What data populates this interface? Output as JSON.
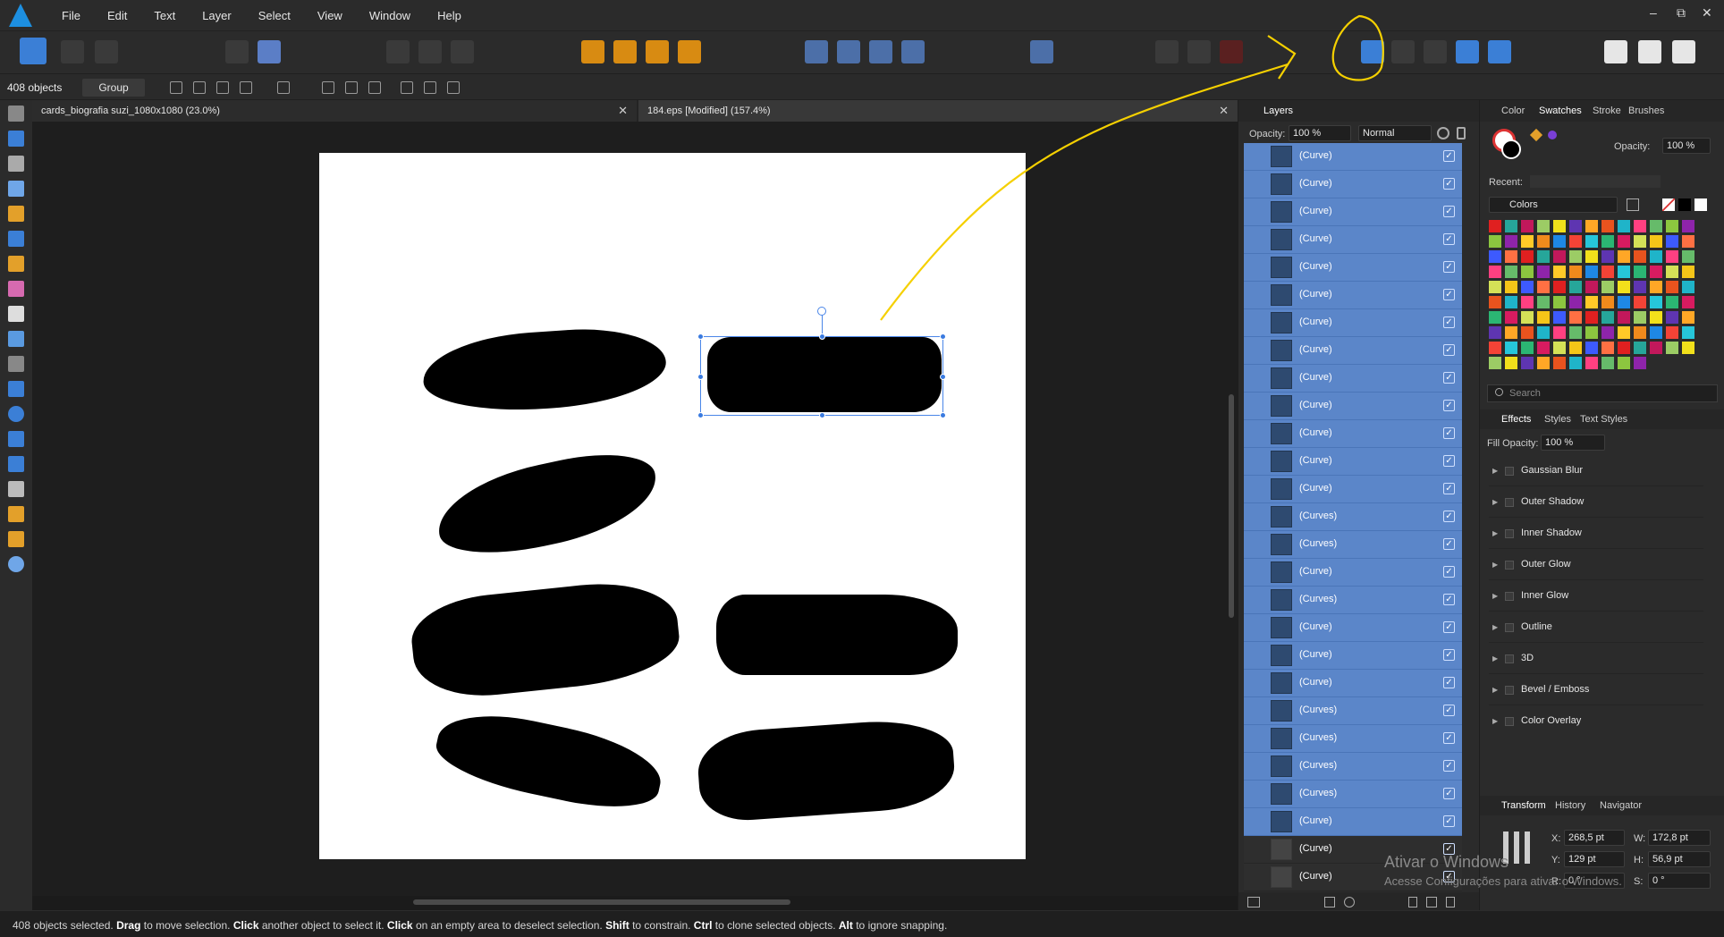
{
  "menu": {
    "items": [
      "File",
      "Edit",
      "Text",
      "Layer",
      "Select",
      "View",
      "Window",
      "Help"
    ]
  },
  "window_controls": {
    "minimize": "–",
    "restore": "⧉",
    "close": "✕"
  },
  "context": {
    "object_count": "408 objects",
    "group_label": "Group"
  },
  "tabs": [
    {
      "label": "cards_biografia suzi_1080x1080 (23.0%)",
      "close": "✕"
    },
    {
      "label": "184.eps [Modified] (157.4%)",
      "close": "✕"
    }
  ],
  "layers_panel": {
    "tab": "Layers",
    "opacity_label": "Opacity:",
    "opacity_value": "100 %",
    "blend_mode": "Normal",
    "rows": [
      "(Curve)",
      "(Curve)",
      "(Curve)",
      "(Curve)",
      "(Curve)",
      "(Curve)",
      "(Curve)",
      "(Curve)",
      "(Curve)",
      "(Curve)",
      "(Curve)",
      "(Curve)",
      "(Curve)",
      "(Curves)",
      "(Curves)",
      "(Curve)",
      "(Curves)",
      "(Curve)",
      "(Curve)",
      "(Curve)",
      "(Curves)",
      "(Curves)",
      "(Curves)",
      "(Curves)",
      "(Curve)",
      "(Curve)",
      "(Curve)"
    ],
    "check": "✓"
  },
  "color_panel": {
    "tabs": [
      "Color",
      "Swatches",
      "Stroke",
      "Brushes"
    ],
    "active_tab": "Swatches",
    "opacity_label": "Opacity:",
    "opacity_value": "100 %",
    "recent_label": "Recent:",
    "palette_name": "Colors",
    "search_placeholder": "Search",
    "palette_colors": [
      "#e02020",
      "#e8531e",
      "#f08a1c",
      "#f5c518",
      "#f2e01b",
      "#8cc63f",
      "#2bb673",
      "#26a69a",
      "#1fb4c9",
      "#1e88e5",
      "#3d5afe",
      "#5e35b1",
      "#8e24aa",
      "#d81b60",
      "#c2185b",
      "#ff4081",
      "#f44336",
      "#ff7043",
      "#ffa726",
      "#ffca28",
      "#d4e157",
      "#9ccc65",
      "#66bb6a",
      "#26c6da"
    ]
  },
  "effects_panel": {
    "tabs": [
      "Effects",
      "Styles",
      "Text Styles"
    ],
    "fill_opacity_label": "Fill Opacity:",
    "fill_opacity_value": "100 %",
    "effects": [
      "Gaussian Blur",
      "Outer Shadow",
      "Inner Shadow",
      "Outer Glow",
      "Inner Glow",
      "Outline",
      "3D",
      "Bevel / Emboss",
      "Color Overlay"
    ]
  },
  "transform_panel": {
    "tabs": [
      "Transform",
      "History",
      "Navigator"
    ],
    "x_label": "X:",
    "x_value": "268,5 pt",
    "y_label": "Y:",
    "y_value": "129 pt",
    "w_label": "W:",
    "w_value": "172,8 pt",
    "h_label": "H:",
    "h_value": "56,9 pt",
    "r_label": "R:",
    "r_value": "0 °",
    "s_label": "S:",
    "s_value": "0 °"
  },
  "watermark": {
    "line1": "Ativar o Windows",
    "line2": "Acesse Configurações para ativar o Windows."
  },
  "status": {
    "p1": "408 objects selected. ",
    "b1": "Drag",
    "p2": " to move selection. ",
    "b2": "Click",
    "p3": " another object to select it. ",
    "b3": "Click",
    "p4": " on an empty area to deselect selection. ",
    "b4": "Shift",
    "p5": " to constrain. ",
    "b5": "Ctrl",
    "p6": " to clone selected objects. ",
    "b6": "Alt",
    "p7": " to ignore snapping."
  },
  "colors": {
    "accent": "#5b86c9",
    "annotation": "#f5d000",
    "selection": "#4a86e8"
  }
}
